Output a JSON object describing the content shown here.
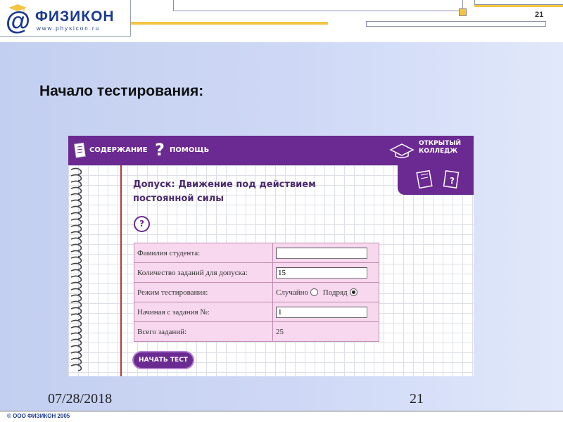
{
  "header": {
    "logo_brand": "ФИЗИКОН",
    "logo_url": "www.physicon.ru",
    "slide_number": "21"
  },
  "slide": {
    "title": "Начало тестирования:"
  },
  "app": {
    "toolbar": {
      "contents_label": "СОДЕРЖАНИЕ",
      "help_label": "ПОМОЩЬ",
      "brand_line1": "ОТКРЫТЫЙ",
      "brand_line2": "КОЛЛЕДЖ"
    },
    "heading_line1": "Допуск: Движение под действием",
    "heading_line2": "постоянной силы",
    "form": {
      "student_label": "Фамилия студента:",
      "student_value": "",
      "tasks_label": "Количество заданий для допуска:",
      "tasks_value": "15",
      "mode_label": "Режим тестирования:",
      "mode_random": "Случайно",
      "mode_sequential": "Подряд",
      "mode_selected": "Подряд",
      "start_label": "Начиная с задания №:",
      "start_value": "1",
      "total_label": "Всего заданий:",
      "total_value": "25"
    },
    "start_button": "НАЧАТЬ ТЕСТ"
  },
  "footer": {
    "date": "07/28/2018",
    "page_number": "21",
    "copyright": "© ООО ФИЗИКОН 2005"
  },
  "colors": {
    "brand_blue": "#1c3a91",
    "app_purple": "#6a2a91",
    "form_pink": "#f7d8ee",
    "accent_gold": "#f4c542"
  }
}
